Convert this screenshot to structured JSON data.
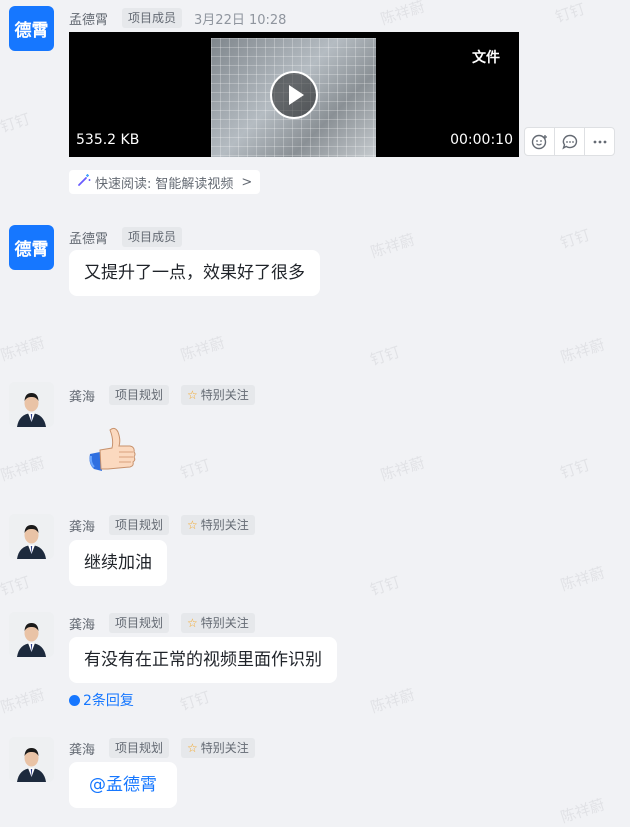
{
  "watermarks": [
    "陈祥蔚",
    "钉钉"
  ],
  "messages": [
    {
      "avatar_text": "德霄",
      "sender": "孟德霄",
      "tags": [
        "项目成员"
      ],
      "time": "3月22日 10:28",
      "video": {
        "label": "文件",
        "size": "535.2 KB",
        "duration": "00:00:10"
      },
      "quick_read": {
        "prefix": "快速阅读:",
        "text": "智能解读视频",
        "chevron": ">"
      }
    },
    {
      "avatar_text": "德霄",
      "sender": "孟德霄",
      "tags": [
        "项目成员"
      ],
      "text": "又提升了一点，效果好了很多"
    },
    {
      "sender": "龚海",
      "tags": [
        "项目规划",
        "特别关注"
      ],
      "emoji": "thumbs-up"
    },
    {
      "sender": "龚海",
      "tags": [
        "项目规划",
        "特别关注"
      ],
      "text": "继续加油"
    },
    {
      "sender": "龚海",
      "tags": [
        "项目规划",
        "特别关注"
      ],
      "text": "有没有在正常的视频里面作识别",
      "replies": "2条回复"
    },
    {
      "sender": "龚海",
      "tags": [
        "项目规划",
        "特别关注"
      ],
      "mention": "@孟德霄"
    }
  ],
  "icons": {
    "play": "play-icon",
    "emoji_react": "add-reaction-icon",
    "reply": "reply-icon",
    "more": "more-icon",
    "magic": "magic-wand-icon",
    "star": "star-icon"
  },
  "colors": {
    "accent": "#1677ff",
    "background": "#f1f2f5",
    "star": "#f5a623"
  }
}
